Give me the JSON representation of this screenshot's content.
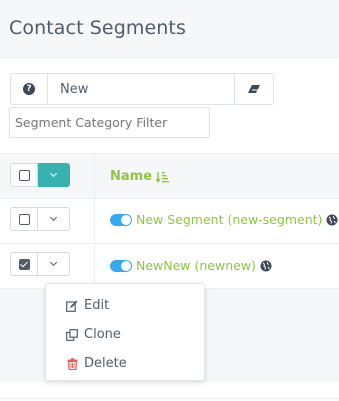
{
  "page": {
    "title": "Contact Segments"
  },
  "search": {
    "value": "New"
  },
  "filter": {
    "placeholder": "Segment Category Filter"
  },
  "table": {
    "column_name": "Name",
    "rows": [
      {
        "label": "New Segment (new-segment)",
        "checked": false,
        "published": true
      },
      {
        "label": "NewNew (newnew)",
        "checked": true,
        "published": true
      }
    ]
  },
  "row_menu": {
    "items": [
      {
        "label": "Edit",
        "icon": "edit-icon"
      },
      {
        "label": "Clone",
        "icon": "clone-icon"
      },
      {
        "label": "Delete",
        "icon": "trash-icon"
      }
    ]
  },
  "colors": {
    "accent_teal": "#36b3b1",
    "link_green": "#8dc63f",
    "toggle_blue": "#36a9f0",
    "danger_red": "#e05a4e"
  }
}
